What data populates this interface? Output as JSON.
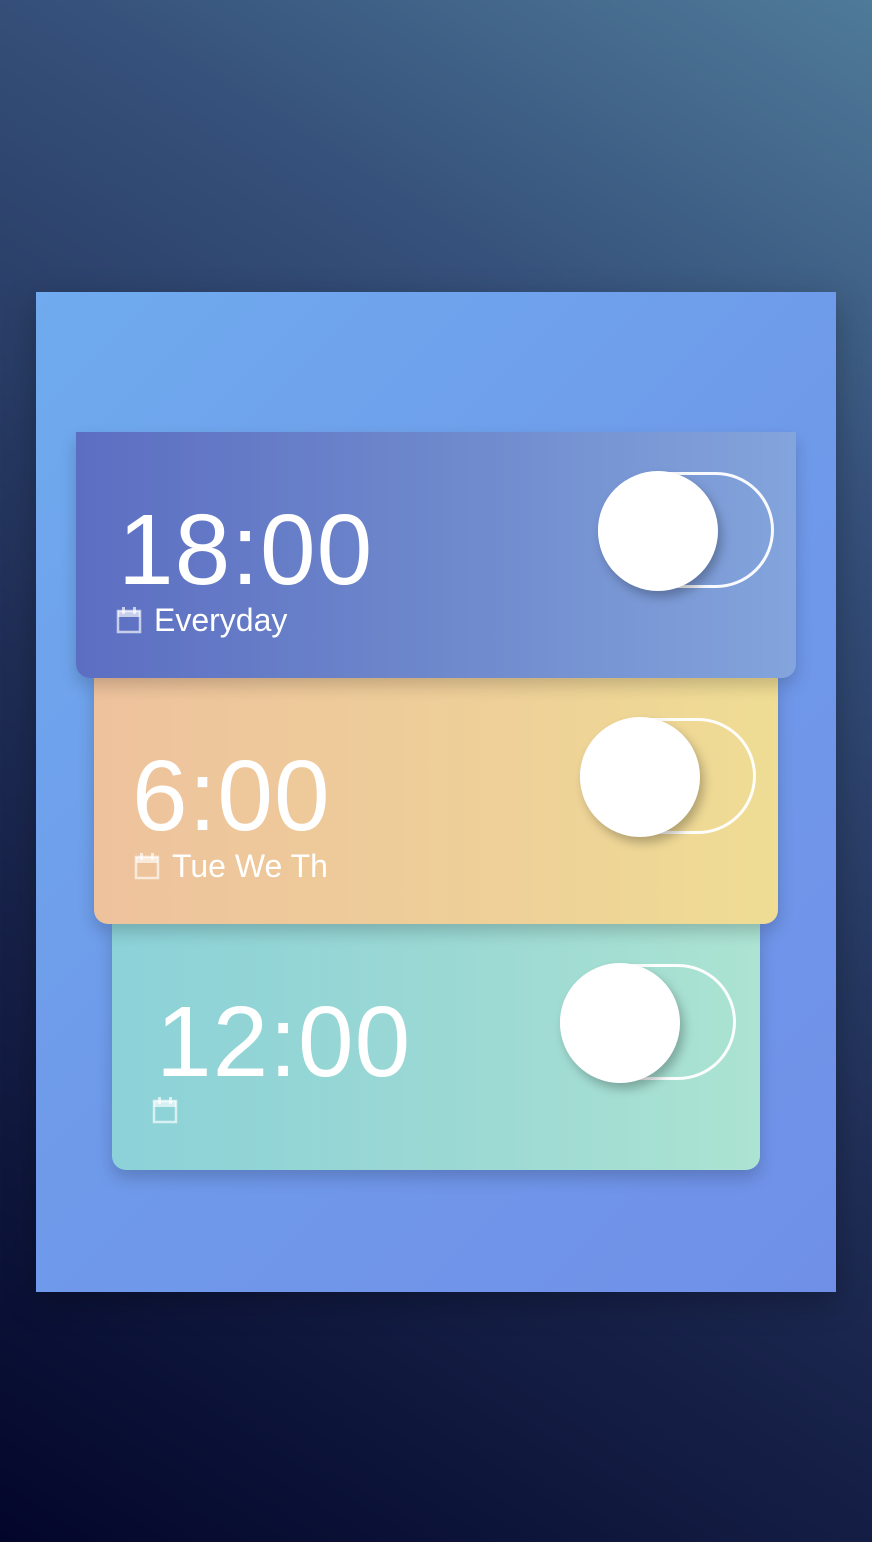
{
  "alarms": [
    {
      "time": "18:00",
      "days": "Everyday",
      "enabled": false
    },
    {
      "time": "6:00",
      "days": "Tue We Th",
      "enabled": false
    },
    {
      "time": "12:00",
      "days": "",
      "enabled": false
    }
  ],
  "icons": {
    "calendar": "calendar-icon"
  },
  "colors": {
    "card1_start": "#5c6ec2",
    "card1_end": "#83a4dc",
    "card2_start": "#eec29d",
    "card2_end": "#efdd94",
    "card3_start": "#8cd2d8",
    "card3_end": "#ace3d2",
    "panel": "#6f9eec"
  }
}
